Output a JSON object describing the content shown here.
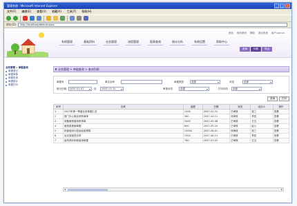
{
  "window": {
    "title": "管理系统 - Microsoft Internet Explorer",
    "controls": [
      "_",
      "□",
      "×"
    ]
  },
  "menubar": [
    "文件(F)",
    "编辑(E)",
    "查看(V)",
    "收藏(A)",
    "工具(T)",
    "帮助(H)"
  ],
  "toolbar": {
    "icons": [
      "back-icon",
      "forward-icon",
      "stop-icon",
      "refresh-icon",
      "home-icon",
      "search-icon",
      "favorites-icon",
      "history-icon",
      "mail-icon",
      "print-icon",
      "edit-icon"
    ],
    "colors": [
      "#3aa33a",
      "#3aa33a",
      "#d33",
      "#3a7bd5",
      "#5a8ad0",
      "#e8b020",
      "#f0c040",
      "#5aa05a",
      "#6a8ad0",
      "#888",
      "#5a6ac0"
    ]
  },
  "addressbar": {
    "label": "地址(D)",
    "url": "http://localhost/default.aspx"
  },
  "header": {
    "top_links": [
      "首页",
      "修改密码",
      "帮助",
      "退出系统",
      "用户:admin"
    ],
    "nav_tabs": [
      "系统管理",
      "基础资料",
      "业务管理",
      "流程管理",
      "报表查询",
      "统计分析",
      "系统设置",
      "帮助中心"
    ],
    "sub_tabs": [
      "查询",
      "列表",
      "导出"
    ]
  },
  "sidebar": {
    "title": "业务管理 » 单据查询",
    "items": [
      "单据登记",
      "单据审核",
      "单据查询",
      "单据统计",
      "单据打印"
    ]
  },
  "main": {
    "breadcrumb": "业务管理 > 单据查询 > 查询列表",
    "filters": {
      "row1": [
        {
          "label": "单据号",
          "value": "",
          "type": "input"
        },
        {
          "label": "单位名称",
          "value": "",
          "type": "input"
        },
        {
          "label": "单据类型",
          "value": "全部",
          "type": "select"
        },
        {
          "label": "状态",
          "value": "全部",
          "type": "select"
        }
      ],
      "row2": [
        {
          "label": "登记日期",
          "value": "2007-01-01",
          "type": "select"
        },
        {
          "label": "至",
          "value": "2007-12-31",
          "type": "select"
        },
        {
          "label": "审核状态",
          "value": "全部",
          "type": "select"
        },
        {
          "label": "打印状态",
          "value": "全部",
          "type": "select"
        }
      ]
    },
    "buttons": [
      "查询",
      "打印"
    ],
    "table": {
      "headers": [
        "序号",
        "名称",
        "金额",
        "日期",
        "状态",
        "经办人",
        "操作"
      ],
      "rows": [
        [
          "1",
          "2007年第一季度业务单据汇总",
          "1200",
          "2007-03-31",
          "已审核",
          "张三",
          "查看"
        ],
        [
          "2",
          "部门办公用品采购清单",
          "560",
          "2007-04-12",
          "待审核",
          "李四",
          "查看"
        ],
        [
          "3",
          "设备维修费用申请单",
          "3400",
          "2007-05-08",
          "已审核",
          "王五",
          "查看"
        ],
        [
          "4",
          "差旅费报销单据",
          "890",
          "2007-05-20",
          "已审核",
          "赵六",
          "查看"
        ],
        [
          "5",
          "年度培训计划及经费预算",
          "15000",
          "2007-06-01",
          "待审核",
          "张三",
          "查看"
        ],
        [
          "6",
          "会议室租赁合同",
          "2300",
          "2007-06-15",
          "已审核",
          "李四",
          "查看"
        ],
        [
          "7",
          "宣传资料印刷费用单据",
          "780",
          "2007-07-02",
          "已审核",
          "王五",
          "查看"
        ]
      ]
    }
  }
}
